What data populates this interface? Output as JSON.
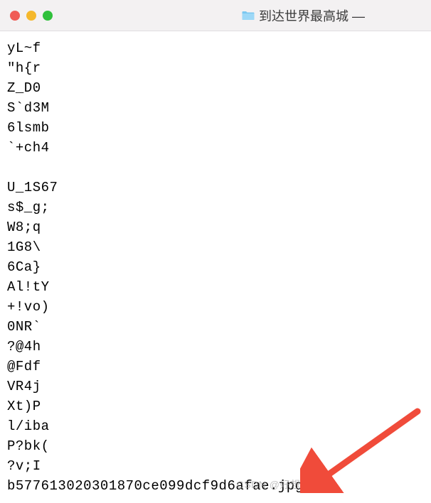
{
  "titlebar": {
    "title": "到达世界最高城 —",
    "folder_icon_name": "folder-icon"
  },
  "traffic_lights": {
    "red": "#f05b55",
    "yellow": "#f5b82c",
    "green": "#30c03b"
  },
  "content": {
    "lines": [
      "yL~f",
      "\"h{r",
      "Z_D0",
      "S`d3M",
      "6lsmb",
      "`+ch4",
      "",
      "U_1S67",
      "s$_g;",
      "W8;q",
      "1G8\\",
      "6Ca}",
      "Al!tY",
      "+!vo)",
      "0NR`",
      "?@4h",
      "@Fdf",
      "VR4j",
      "Xt)P",
      "l/iba",
      "P?bk(",
      "?v;I",
      "b577613020301870ce099dcf9d6afae.jpg"
    ]
  },
  "watermark": "CSDN @好想变强啊",
  "annotation": {
    "arrow_color": "#f04b3a"
  }
}
